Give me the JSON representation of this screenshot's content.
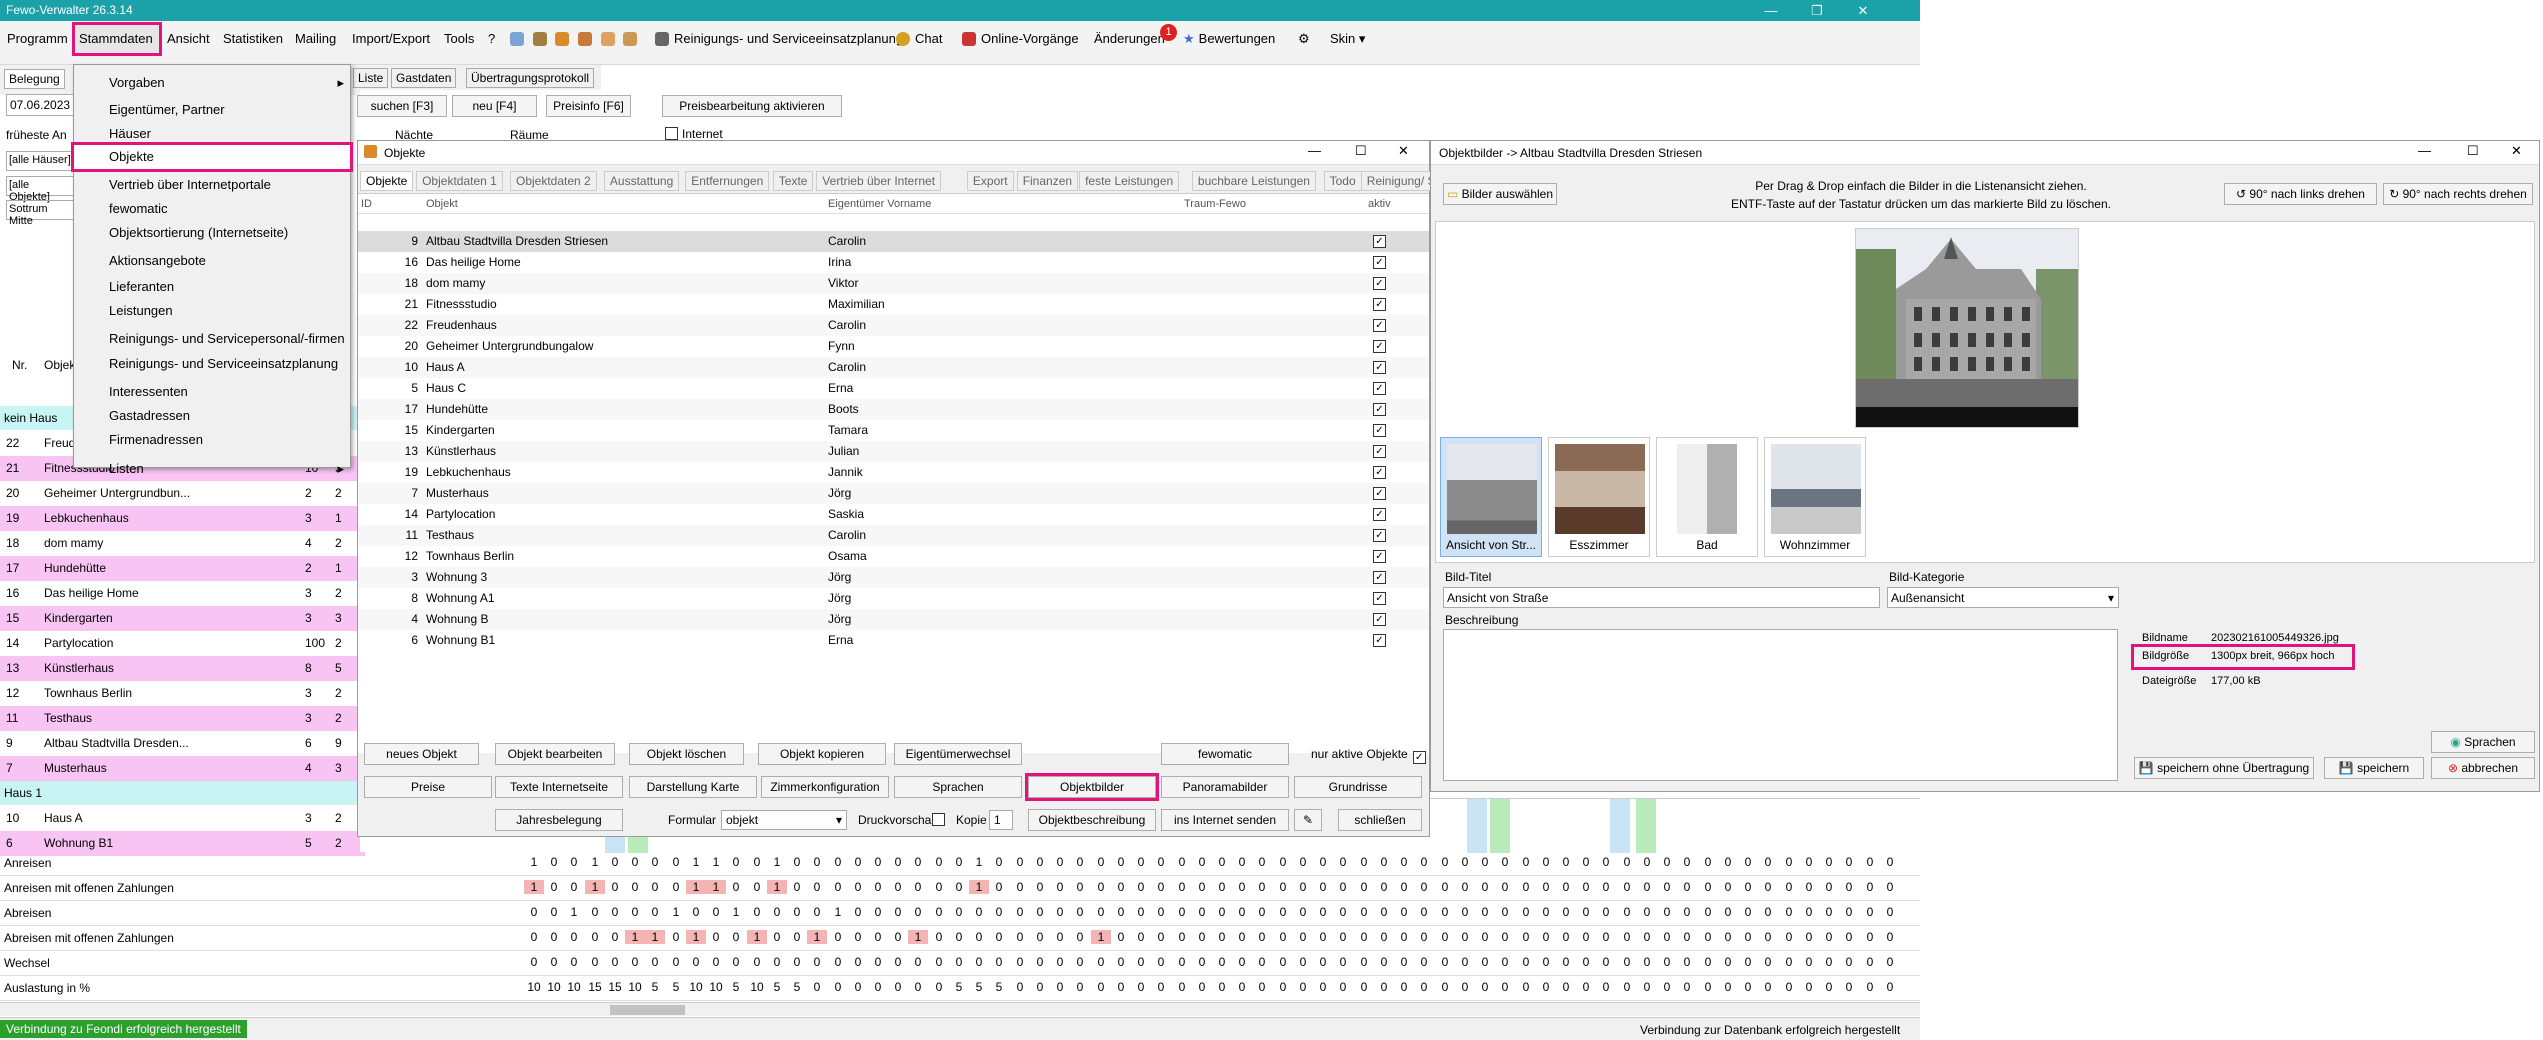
{
  "app": {
    "title": "Fewo-Verwalter 26.3.14",
    "notif_badge": "1"
  },
  "menu": [
    "Programm",
    "Stammdaten",
    "Ansicht",
    "Statistiken",
    "Mailing",
    "Import/Export",
    "Tools",
    "?"
  ],
  "toolbar": {
    "cleaning": "Reinigungs- und Serviceeinsatzplanung",
    "chat": "Chat",
    "online": "Online-Vorgänge",
    "changes": "Änderungen",
    "reviews": "Bewertungen",
    "skin": "Skin ▾"
  },
  "dropdown": [
    "Vorgaben",
    "Eigentümer, Partner",
    "Häuser",
    "Objekte",
    "Vertrieb über Internetportale",
    "fewomatic",
    "Objektsortierung (Internetseite)",
    "Aktionsangebote",
    "Lieferanten",
    "Leistungen",
    "Reinigungs- und Servicepersonal/-firmen",
    "Reinigungs- und Serviceeinsatzplanung",
    "Interessenten",
    "Gastadressen",
    "Firmenadressen",
    "Listen"
  ],
  "back": {
    "tabs": [
      "Belegung",
      "Liste",
      "Gastdaten",
      "Übertragungsprotokoll"
    ],
    "date": "07.06.2023",
    "earliest": "früheste An",
    "filters": [
      "[alle Häuser]",
      "[alle Objekte]",
      "Sottrum Mitte"
    ],
    "buttons": [
      "suchen [F3]",
      "neu [F4]",
      "Preisinfo [F6]",
      "Preisbearbeitung aktivieren"
    ],
    "nights_label": "Nächte",
    "rooms_label": "Räume",
    "internet_label": "Internet",
    "col_nr": "Nr.",
    "col_obj": "Objekt",
    "group_kein": "kein Haus",
    "group_haus1": "Haus 1"
  },
  "left_rows": [
    {
      "nr": "22",
      "name": "Freudenhaus",
      "a": "",
      "b": "",
      "pink": false
    },
    {
      "nr": "21",
      "name": "Fitnessstudio",
      "a": "10",
      "b": "5",
      "pink": true
    },
    {
      "nr": "20",
      "name": "Geheimer Untergrundbun...",
      "a": "2",
      "b": "2",
      "pink": false
    },
    {
      "nr": "19",
      "name": "Lebkuchenhaus",
      "a": "3",
      "b": "1",
      "pink": true
    },
    {
      "nr": "18",
      "name": "dom mamy",
      "a": "4",
      "b": "2",
      "pink": false
    },
    {
      "nr": "17",
      "name": "Hundehütte",
      "a": "2",
      "b": "1",
      "pink": true
    },
    {
      "nr": "16",
      "name": "Das heilige Home",
      "a": "3",
      "b": "2",
      "pink": false
    },
    {
      "nr": "15",
      "name": "Kindergarten",
      "a": "3",
      "b": "3",
      "pink": true
    },
    {
      "nr": "14",
      "name": "Partylocation",
      "a": "100",
      "b": "2",
      "pink": false
    },
    {
      "nr": "13",
      "name": "Künstlerhaus",
      "a": "8",
      "b": "5",
      "pink": true
    },
    {
      "nr": "12",
      "name": "Townhaus Berlin",
      "a": "3",
      "b": "2",
      "pink": false
    },
    {
      "nr": "11",
      "name": "Testhaus",
      "a": "3",
      "b": "2",
      "pink": true
    },
    {
      "nr": "9",
      "name": "Altbau Stadtvilla Dresden...",
      "a": "6",
      "b": "9",
      "pink": false
    },
    {
      "nr": "7",
      "name": "Musterhaus",
      "a": "4",
      "b": "3",
      "pink": true
    }
  ],
  "left_rows2": [
    {
      "nr": "10",
      "name": "Haus A",
      "a": "3",
      "b": "2",
      "pink": false
    },
    {
      "nr": "6",
      "name": "Wohnung B1",
      "a": "5",
      "b": "2",
      "pink": true
    }
  ],
  "summary": {
    "labels": [
      "Anreisen",
      "Anreisen mit offenen Zahlungen",
      "Abreisen",
      "Abreisen mit offenen Zahlungen",
      "Wechsel",
      "Auslastung in %"
    ],
    "rows": [
      "1 0 0 1 0 0 0 0 1 1 0 0 1 0 0 0 0 0 0 0 0 0 1 0 0 0 0 0 0 0 0 0 0 0 0 0 0 0 0 0 0 0 0 0 0 0 0 0 0 0 0 0 0 0 0 0 0 0 0 0 0 0 0 0 0 0 0 0",
      "1 0 0 1 0 0 0 0 1 1 0 0 1 0 0 0 0 0 0 0 0 0 1 0 0 0 0 0 0 0 0 0 0 0 0 0 0 0 0 0 0 0 0 0 0 0 0 0 0 0 0 0 0 0 0 0 0 0 0 0 0 0 0 0 0 0 0 0",
      "0 0 1 0 0 0 0 1 0 0 1 0 0 0 0 1 0 0 0 0 0 0 0 0 0 0 0 0 0 0 0 0 0 0 0 0 0 0 0 0 0 0 0 0 0 0 0 0 0 0 0 0 0 0 0 0 0 0 0 0 0 0 0 0 0 0 0 0",
      "0 0 0 0 0 1 1 0 1 0 0 1 0 0 1 0 0 0 0 1 0 0 0 0 0 0 0 0 1 0 0 0 0 0 0 0 0 0 0 0 0 0 0 0 0 0 0 0 0 0 0 0 0 0 0 0 0 0 0 0 0 0 0 0 0 0 0 0",
      "0 0 0 0 0 0 0 0 0 0 0 0 0 0 0 0 0 0 0 0 0 0 0 0 0 0 0 0 0 0 0 0 0 0 0 0 0 0 0 0 0 0 0 0 0 0 0 0 0 0 0 0 0 0 0 0 0 0 0 0 0 0 0 0 0 0 0 0",
      "10 10 10 15 15 10 5 5 10 10 5 10 5 5 0 0 0 0 0 0 0 5 5 5 0 0 0 0 0 0 0 0 0 0 0 0 0 0 0 0 0 0 0 0 0 0 0 0 0 0 0 0 0 0 0 0 0 0 0 0 0 0 0 0 0 0 0 0"
    ]
  },
  "objekte": {
    "title": "Objekte",
    "tabs": [
      "Objekte",
      "Objektdaten 1",
      "Objektdaten 2",
      "Ausstattung",
      "Entfernungen",
      "Texte",
      "Vertrieb über Internet",
      "Export",
      "Finanzen",
      "feste Leistungen",
      "buchbare Leistungen",
      "Todo",
      "Reinigung/ Serviceeinsätze"
    ],
    "headers": [
      "ID",
      "Objekt",
      "Eigentümer Vorname",
      "Traum-Fewo",
      "aktiv"
    ],
    "rows": [
      {
        "id": "9",
        "name": "Altbau Stadtvilla Dresden Striesen",
        "owner": "Carolin"
      },
      {
        "id": "16",
        "name": "Das heilige Home",
        "owner": "Irina"
      },
      {
        "id": "18",
        "name": "dom mamy",
        "owner": "Viktor"
      },
      {
        "id": "21",
        "name": "Fitnessstudio",
        "owner": "Maximilian"
      },
      {
        "id": "22",
        "name": "Freudenhaus",
        "owner": "Carolin"
      },
      {
        "id": "20",
        "name": "Geheimer Untergrundbungalow",
        "owner": "Fynn"
      },
      {
        "id": "10",
        "name": "Haus A",
        "owner": "Carolin"
      },
      {
        "id": "5",
        "name": "Haus C",
        "owner": "Erna"
      },
      {
        "id": "17",
        "name": "Hundehütte",
        "owner": "Boots"
      },
      {
        "id": "15",
        "name": "Kindergarten",
        "owner": "Tamara"
      },
      {
        "id": "13",
        "name": "Künstlerhaus",
        "owner": "Julian"
      },
      {
        "id": "19",
        "name": "Lebkuchenhaus",
        "owner": "Jannik"
      },
      {
        "id": "7",
        "name": "Musterhaus",
        "owner": "Jörg"
      },
      {
        "id": "14",
        "name": "Partylocation",
        "owner": "Saskia"
      },
      {
        "id": "11",
        "name": "Testhaus",
        "owner": "Carolin"
      },
      {
        "id": "12",
        "name": "Townhaus Berlin",
        "owner": "Osama"
      },
      {
        "id": "3",
        "name": "Wohnung 3",
        "owner": "Jörg"
      },
      {
        "id": "8",
        "name": "Wohnung A1",
        "owner": "Jörg"
      },
      {
        "id": "4",
        "name": "Wohnung B",
        "owner": "Jörg"
      },
      {
        "id": "6",
        "name": "Wohnung B1",
        "owner": "Erna"
      }
    ],
    "btn": {
      "neues": "neues Objekt",
      "bearbeiten": "Objekt bearbeiten",
      "loeschen": "Objekt löschen",
      "kopieren": "Objekt kopieren",
      "wechsel": "Eigentümerwechsel",
      "fewomatic": "fewomatic",
      "nur_aktive": "nur aktive Objekte",
      "preise": "Preise",
      "texte": "Texte Internetseite",
      "karte": "Darstellung Karte",
      "zimmer": "Zimmerkonfiguration",
      "sprachen": "Sprachen",
      "bilder": "Objektbilder",
      "panorama": "Panoramabilder",
      "grundriss": "Grundrisse",
      "jahres": "Jahresbelegung",
      "formular": "Formular",
      "formular_val": "objekt",
      "druck": "Druckvorschau",
      "kopie": "Kopie",
      "kopie_val": "1",
      "beschreibung": "Objektbeschreibung",
      "internet": "ins Internet senden",
      "schliessen": "schließen"
    }
  },
  "bilder": {
    "title": "Objektbilder -> Altbau Stadtvilla Dresden Striesen",
    "select": "Bilder auswählen",
    "hint1": "Per Drag & Drop einfach die Bilder in die Listenansicht ziehen.",
    "hint2": "ENTF-Taste auf der Tastatur drücken um das markierte Bild zu löschen.",
    "rot_left": "90° nach links drehen",
    "rot_right": "90° nach rechts drehen",
    "thumbs": [
      "Ansicht von Str...",
      "Esszimmer",
      "Bad",
      "Wohnzimmer"
    ],
    "title_label": "Bild-Titel",
    "title_val": "Ansicht von Straße",
    "cat_label": "Bild-Kategorie",
    "cat_val": "Außenansicht",
    "desc_label": "Beschreibung",
    "name_label": "Bildname",
    "name_val": "202302161005449326.jpg",
    "size_label": "Bildgröße",
    "size_val": "1300px breit, 966px hoch",
    "file_label": "Dateigröße",
    "file_val": "177,00 kB",
    "sprachen": "Sprachen",
    "save_no": "speichern ohne Übertragung",
    "save": "speichern",
    "cancel": "abbrechen"
  },
  "status": {
    "left": "Verbindung zu Feondi erfolgreich hergestellt",
    "right": "Verbindung zur Datenbank erfolgreich hergestellt"
  }
}
